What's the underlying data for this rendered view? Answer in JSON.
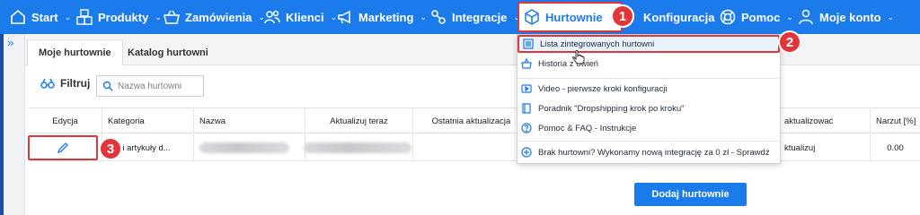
{
  "nav": {
    "start": "Start",
    "produkty": "Produkty",
    "zamowienia": "Zamówienia",
    "klienci": "Klienci",
    "marketing": "Marketing",
    "integracje": "Integracje",
    "hurtownie": "Hurtownie",
    "konfiguracja": "Konfiguracja",
    "pomoc": "Pomoc",
    "moje_konto": "Moje konto"
  },
  "tabs": [
    "Moje hurtownie",
    "Katalog hurtowni"
  ],
  "filter": {
    "label": "Filtruj",
    "placeholder": "Nazwa hurtowni"
  },
  "table": {
    "headers": [
      "Edycja",
      "Kategoria",
      "Nazwa",
      "Aktualizuj teraz",
      "Ostatnia aktualizacja",
      "aktualizować",
      "Narzut [%]"
    ],
    "row": {
      "kategoria": "wki i artykuły d...",
      "aktualizowac": "ktualizuj",
      "narzut": "0.00"
    }
  },
  "add_button": "Dodaj hurtownie",
  "dropdown": [
    {
      "label": "Lista zintegrowanych hurtowni",
      "icon": "list-icon"
    },
    {
      "label": "Historia z  ówień",
      "icon": "basket-icon"
    },
    {
      "label": "Video - pierwsze kroki konfiguracji",
      "icon": "video-icon"
    },
    {
      "label": "Poradnik \"Dropshipping krok po kroku\"",
      "icon": "book-icon"
    },
    {
      "label": "Pomoc & FAQ - Instrukcje",
      "icon": "help-icon"
    },
    {
      "label": "Brak hurtowni? Wykonamy nową integrację za 0 zł - Sprawdź",
      "icon": "plus-icon"
    }
  ],
  "badges": [
    "1",
    "2",
    "3"
  ],
  "colors": {
    "primary": "#1c7bea",
    "highlight": "#e0363a"
  }
}
